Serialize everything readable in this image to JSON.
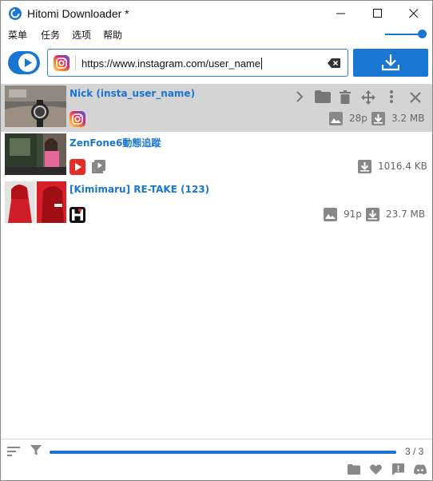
{
  "window": {
    "title": "Hitomi Downloader *",
    "icons": [
      "app-icon",
      "minimize-icon",
      "maximize-icon",
      "close-icon"
    ]
  },
  "menu": {
    "items": [
      {
        "label": "菜单"
      },
      {
        "label": "任务"
      },
      {
        "label": "选项"
      },
      {
        "label": "帮助"
      }
    ],
    "zoom_slider": 0.9
  },
  "url_bar": {
    "value": "https://www.instagram.com/user_name",
    "site_icon": "instagram-icon",
    "clear_icon": "backspace-clear-icon",
    "download_icon": "download-icon",
    "play_toggle_icon": "play-toggle-icon"
  },
  "tasks": [
    {
      "title": "Nick (insta_user_name)",
      "site": "instagram",
      "pages": "28p",
      "size": "3.2 MB",
      "selected": true,
      "actions": [
        "chevron-right-icon",
        "folder-icon",
        "trash-icon",
        "move-icon",
        "more-vert-icon",
        "close-icon"
      ]
    },
    {
      "title": "ZenFone6動態追蹤",
      "site": "youtube",
      "pages": "",
      "size": "1016.4 KB",
      "selected": false
    },
    {
      "title": "[Kimimaru] RE-TAKE (123)",
      "site": "hitomi",
      "pages": "91p",
      "size": "23.7 MB",
      "selected": false
    }
  ],
  "status": {
    "progress": 1.0,
    "progress_text": "3 / 3"
  },
  "colors": {
    "accent": "#1976d2",
    "selected_row": "#d4d4d4",
    "title_blue": "#1976d2",
    "youtube_red": "#e52d27"
  }
}
